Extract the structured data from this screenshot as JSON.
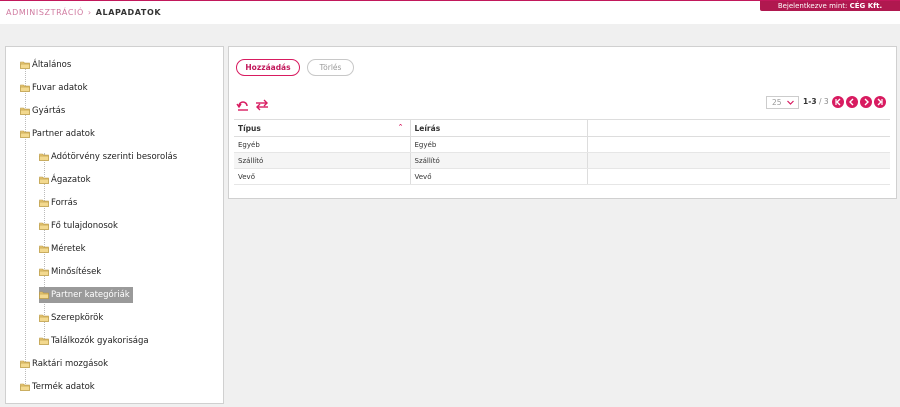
{
  "header": {
    "breadcrumb_root": "ADMINISZTRÁCIÓ",
    "breadcrumb_separator": "›",
    "breadcrumb_current": "ALAPADATOK",
    "login_prefix": "Bejelentkezve mint:",
    "login_user": "CÉG Kft."
  },
  "colors": {
    "accent": "#d81b60",
    "selected_bg": "#9a9a9a"
  },
  "tree": {
    "items": [
      {
        "label": "Általános",
        "icon": "folder-icon",
        "level": 0
      },
      {
        "label": "Fuvar adatok",
        "icon": "folder-icon",
        "level": 0
      },
      {
        "label": "Gyártás",
        "icon": "folder-icon",
        "level": 0
      },
      {
        "label": "Partner adatok",
        "icon": "folder-icon",
        "level": 0
      },
      {
        "label": "Adótörvény szerinti besorolás",
        "icon": "folder-icon",
        "level": 1
      },
      {
        "label": "Ágazatok",
        "icon": "folder-icon",
        "level": 1
      },
      {
        "label": "Forrás",
        "icon": "folder-icon",
        "level": 1
      },
      {
        "label": "Fő tulajdonosok",
        "icon": "folder-icon",
        "level": 1
      },
      {
        "label": "Méretek",
        "icon": "folder-icon",
        "level": 1
      },
      {
        "label": "Minősítések",
        "icon": "folder-icon",
        "level": 1
      },
      {
        "label": "Partner kategóriák",
        "icon": "folder-icon",
        "level": 1,
        "selected": true
      },
      {
        "label": "Szerepkörök",
        "icon": "folder-icon",
        "level": 1
      },
      {
        "label": "Találkozók gyakorisága",
        "icon": "folder-icon",
        "level": 1
      },
      {
        "label": "Raktári mozgások",
        "icon": "folder-icon",
        "level": 0
      },
      {
        "label": "Termék adatok",
        "icon": "folder-icon",
        "level": 0
      }
    ]
  },
  "toolbar": {
    "add_label": "Hozzáadás",
    "delete_label": "Törlés",
    "refresh_icon": "refresh-icon",
    "swap_icon": "swap-icon"
  },
  "pager": {
    "page_size": "25",
    "range": "1-3",
    "separator": "/",
    "total": "3",
    "first_icon": "first-page-icon",
    "prev_icon": "prev-page-icon",
    "next_icon": "next-page-icon",
    "last_icon": "last-page-icon"
  },
  "table": {
    "columns": [
      "Típus",
      "Leírás",
      ""
    ],
    "sorted_column": "Típus",
    "rows": [
      [
        "Egyéb",
        "Egyéb",
        ""
      ],
      [
        "Szállító",
        "Szállító",
        ""
      ],
      [
        "Vevő",
        "Vevő",
        ""
      ]
    ]
  }
}
